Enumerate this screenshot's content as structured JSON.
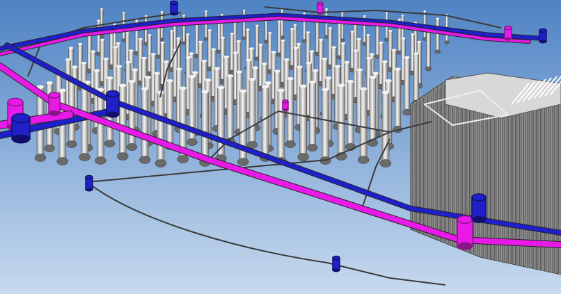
{
  "viewport": {
    "background_top": "#4f83c4",
    "background_bottom": "#c8daee"
  },
  "colors": {
    "magenta_pipe": "#e81ae8",
    "magenta_dark": "#8a148a",
    "blue_pipe": "#2020c8",
    "blue_dark": "#10106a",
    "pile_light": "#f2f2f2",
    "pile_shadow": "#6a6a6a",
    "sheet_pile_wall": "#8c8c8c",
    "sheet_pile_dark": "#3a3a3a",
    "thin_line": "#3a3a3a"
  },
  "model_elements": {
    "pile_rows": 9,
    "piles_per_row_approx": 18,
    "sheet_pile_enclosure": "right-side",
    "pipe_networks": [
      "magenta-pipe",
      "blue-pipe"
    ]
  }
}
